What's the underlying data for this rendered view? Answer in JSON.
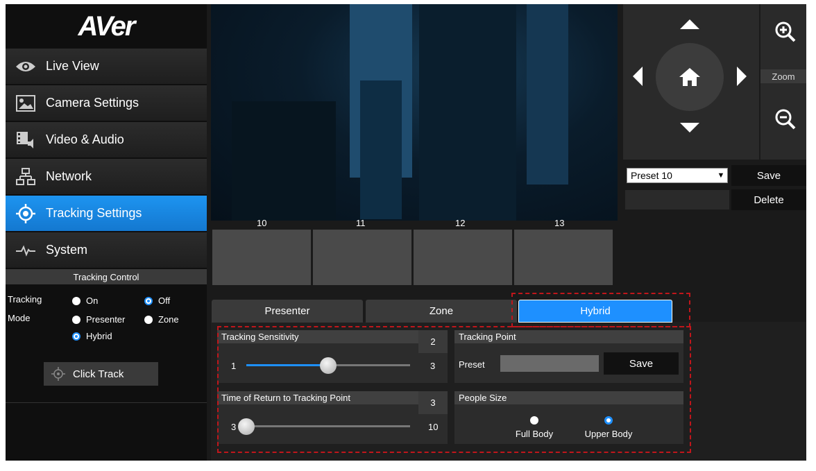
{
  "brand": {
    "logo": "AVer"
  },
  "sidebar": {
    "items": [
      {
        "label": "Live View",
        "icon": "eye-icon"
      },
      {
        "label": "Camera Settings",
        "icon": "image-icon"
      },
      {
        "label": "Video & Audio",
        "icon": "film-speaker-icon"
      },
      {
        "label": "Network",
        "icon": "network-icon"
      },
      {
        "label": "Tracking Settings",
        "icon": "target-icon",
        "active": true
      },
      {
        "label": "System",
        "icon": "pulse-icon"
      }
    ]
  },
  "tracking_control": {
    "header": "Tracking Control",
    "tracking_label": "Tracking",
    "tracking_on": "On",
    "tracking_off": "Off",
    "tracking_value": "Off",
    "mode_label": "Mode",
    "mode_presenter": "Presenter",
    "mode_zone": "Zone",
    "mode_hybrid": "Hybrid",
    "mode_value": "Hybrid",
    "click_track": "Click Track"
  },
  "thumbnails": [
    "10",
    "11",
    "12",
    "13"
  ],
  "ptz": {
    "zoom_label": "Zoom"
  },
  "presets": {
    "selected": "Preset 10",
    "save": "Save",
    "delete": "Delete"
  },
  "tabs": [
    {
      "label": "Presenter"
    },
    {
      "label": "Zone"
    },
    {
      "label": "Hybrid",
      "active": true
    }
  ],
  "tracking_sensitivity": {
    "title": "Tracking Sensitivity",
    "value": "2",
    "min": "1",
    "max": "3",
    "level": 2
  },
  "tracking_point": {
    "title": "Tracking Point",
    "preset_label": "Preset",
    "save": "Save"
  },
  "time_of_return": {
    "title": "Time of Return to Tracking Point",
    "value": "3",
    "min": "3",
    "max": "10",
    "level": 3
  },
  "people_size": {
    "title": "People Size",
    "full_body": "Full Body",
    "upper_body": "Upper Body",
    "selected": "Upper Body"
  },
  "colors": {
    "accent": "#1e90ff",
    "highlight": "#c0161b"
  }
}
